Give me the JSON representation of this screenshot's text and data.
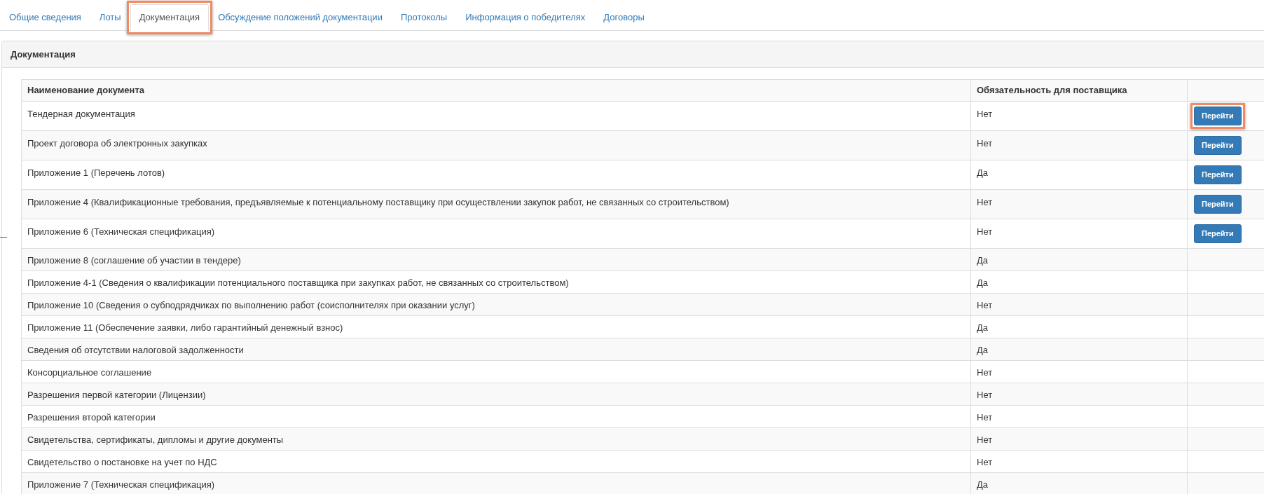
{
  "tabs": [
    {
      "label": "Общие сведения",
      "selected": false,
      "highlighted": false
    },
    {
      "label": "Лоты",
      "selected": false,
      "highlighted": false
    },
    {
      "label": "Документация",
      "selected": true,
      "highlighted": true
    },
    {
      "label": "Обсуждение положений документации",
      "selected": false,
      "highlighted": false
    },
    {
      "label": "Протоколы",
      "selected": false,
      "highlighted": false
    },
    {
      "label": "Информация о победителях",
      "selected": false,
      "highlighted": false
    },
    {
      "label": "Договоры",
      "selected": false,
      "highlighted": false
    }
  ],
  "panel": {
    "title": "Документация"
  },
  "table": {
    "columns": [
      "Наименование документа",
      "Обязательность для поставщика"
    ],
    "rows": [
      {
        "name": "Тендерная документация",
        "required": "Нет",
        "button": {
          "label": "Перейти",
          "highlighted": true
        }
      },
      {
        "name": "Проект договора об электронных закупках",
        "required": "Нет",
        "button": {
          "label": "Перейти",
          "highlighted": false
        }
      },
      {
        "name": "Приложение 1 (Перечень лотов)",
        "required": "Да",
        "button": {
          "label": "Перейти",
          "highlighted": false
        }
      },
      {
        "name": "Приложение 4 (Квалификационные требования, предъявляемые к потенциальному поставщику при осуществлении закупок работ, не связанных со строительством)",
        "required": "Нет",
        "button": {
          "label": "Перейти",
          "highlighted": false
        }
      },
      {
        "name": "Приложение 6 (Техническая спецификация)",
        "required": "Нет",
        "button": {
          "label": "Перейти",
          "highlighted": false
        }
      },
      {
        "name": "Приложение 8 (соглашение об участии в тендере)",
        "required": "Да"
      },
      {
        "name": "Приложение 4-1 (Сведения о квалификации потенциального поставщика при закупках работ, не связанных со строительством)",
        "required": "Да"
      },
      {
        "name": "Приложение 10 (Сведения о субподрядчиках по выполнению работ (соисполнителях при оказании услуг)",
        "required": "Нет"
      },
      {
        "name": "Приложение 11 (Обеспечение заявки, либо гарантийный денежный взнос)",
        "required": "Да"
      },
      {
        "name": "Сведения об отсутствии налоговой задолженности",
        "required": "Да"
      },
      {
        "name": "Консорциальное соглашение",
        "required": "Нет"
      },
      {
        "name": "Разрешения первой категории (Лицензии)",
        "required": "Нет"
      },
      {
        "name": "Разрешения второй категории",
        "required": "Нет"
      },
      {
        "name": "Свидетельства, сертификаты, дипломы и другие документы",
        "required": "Нет"
      },
      {
        "name": "Свидетельство о постановке на учет по НДС",
        "required": "Нет"
      },
      {
        "name": "Приложение 7 (Техническая спецификация)",
        "required": "Да"
      }
    ]
  }
}
